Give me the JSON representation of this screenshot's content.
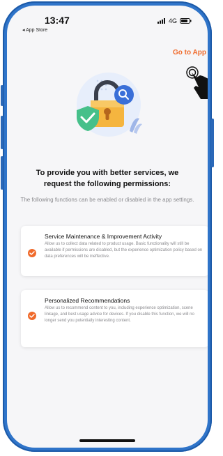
{
  "status_bar": {
    "time": "13:47",
    "back_label": "◂ App Store",
    "network": "4G"
  },
  "header": {
    "go_to_app": "Go to App",
    "accent_color": "#f06a2b"
  },
  "illustration": {
    "icon": "padlock-shield-search-illustration"
  },
  "title": "To provide you with better services, we request the following permissions:",
  "subtitle": "The following functions can be enabled or disabled in the app settings.",
  "permissions": [
    {
      "title": "Service Maintenance & Improvement Activity",
      "description": "Allow us to collect data related to product usage. Basic functionality will still be available if permissions are disabled, but the experience optimization policy based on data preferences will be ineffective.",
      "checked": true
    },
    {
      "title": "Personalized Recommendations",
      "description": "Allow us to recommend content to you, including experience optimization, scene linkage, and best usage advice for devices. If you disable this function, we will no longer send you potentially interesting content.",
      "checked": true
    }
  ]
}
